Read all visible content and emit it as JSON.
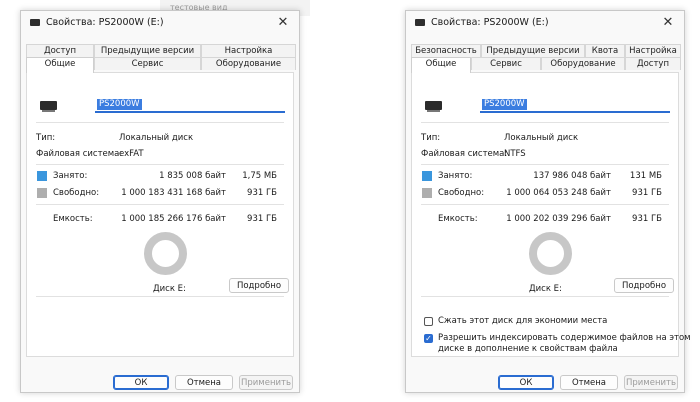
{
  "background": {
    "text": "тестовые вид"
  },
  "dialogs": [
    {
      "title": "Свойства: PS2000W (E:)",
      "tabs_row1": [
        "Доступ",
        "Предыдущие версии",
        "Настройка"
      ],
      "tabs_row2": [
        "Общие",
        "Сервис",
        "Оборудование"
      ],
      "drive_name": "PS2000W",
      "type_label": "Тип:",
      "type_value": "Локальный диск",
      "fs_label": "Файловая система:",
      "fs_value": "exFAT",
      "used_label": "Занято:",
      "used_bytes": "1 835 008 байт",
      "used_size": "1,75 МБ",
      "free_label": "Свободно:",
      "free_bytes": "1 000 183 431 168 байт",
      "free_size": "931 ГБ",
      "cap_label": "Емкость:",
      "cap_bytes": "1 000 185 266 176 байт",
      "cap_size": "931 ГБ",
      "disk_label": "Диск E:",
      "details_btn": "Подробно",
      "ok_btn": "ОК",
      "cancel_btn": "Отмена",
      "apply_btn": "Применить"
    },
    {
      "title": "Свойства: PS2000W (E:)",
      "tabs_row1": [
        "Безопасность",
        "Предыдущие версии",
        "Квота",
        "Настройка"
      ],
      "tabs_row2": [
        "Общие",
        "Сервис",
        "Оборудование",
        "Доступ"
      ],
      "drive_name": "PS2000W",
      "type_label": "Тип:",
      "type_value": "Локальный диск",
      "fs_label": "Файловая система:",
      "fs_value": "NTFS",
      "used_label": "Занято:",
      "used_bytes": "137 986 048 байт",
      "used_size": "131 МБ",
      "free_label": "Свободно:",
      "free_bytes": "1 000 064 053 248 байт",
      "free_size": "931 ГБ",
      "cap_label": "Емкость:",
      "cap_bytes": "1 000 202 039 296 байт",
      "cap_size": "931 ГБ",
      "disk_label": "Диск E:",
      "details_btn": "Подробно",
      "compress_label": "Сжать этот диск для экономии места",
      "index_label_1": "Разрешить индексировать содержимое файлов на этом",
      "index_label_2": "диске в дополнение к свойствам файла",
      "compress_checked": false,
      "index_checked": true,
      "ok_btn": "ОК",
      "cancel_btn": "Отмена",
      "apply_btn": "Применить"
    }
  ],
  "colors": {
    "used": "#3a96dd",
    "free": "#aeaeae",
    "accent": "#2a6cd1"
  }
}
